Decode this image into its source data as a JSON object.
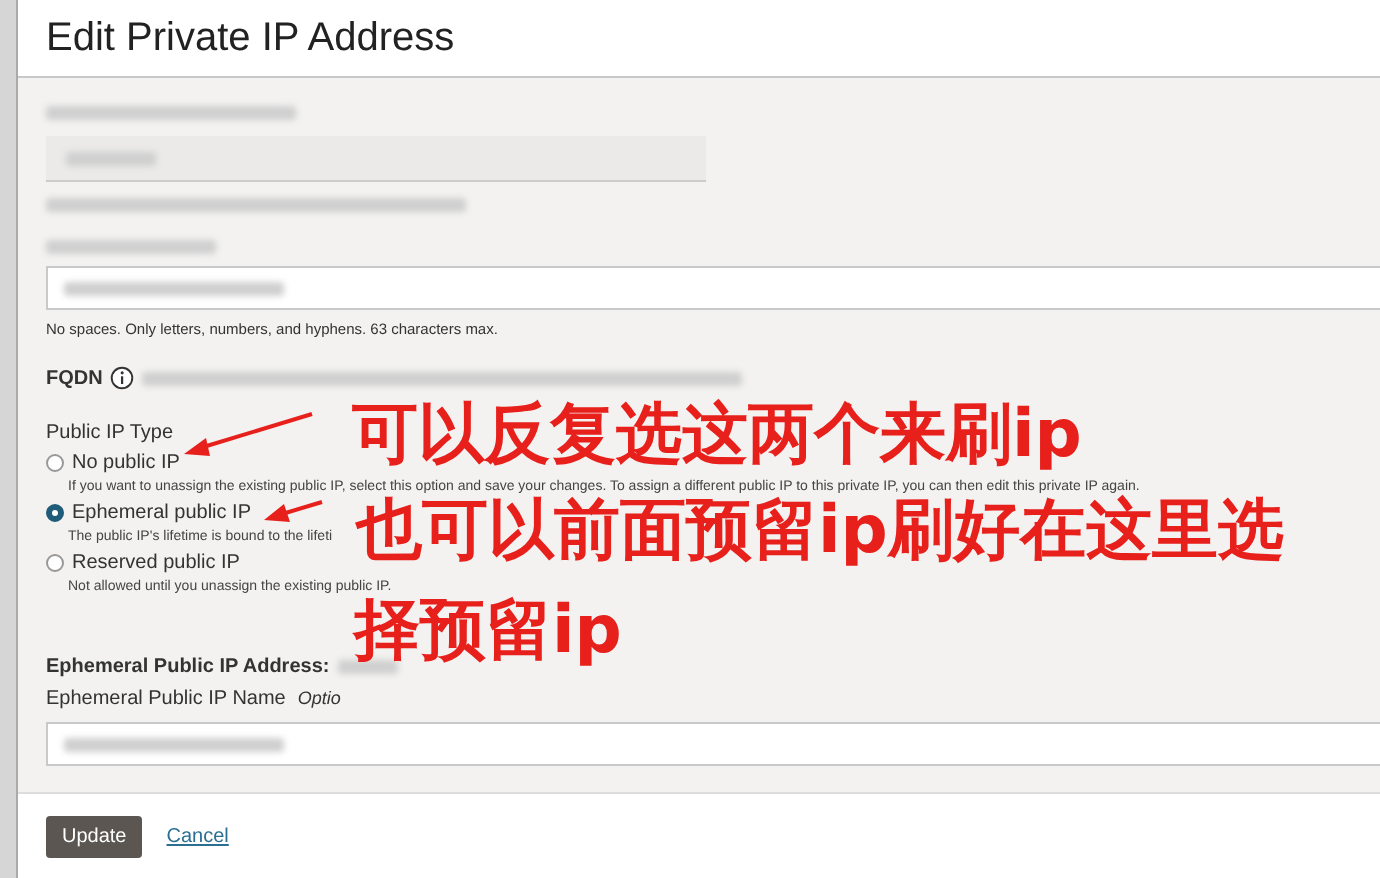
{
  "dialog": {
    "title": "Edit Private IP Address"
  },
  "hostname_hint": "No spaces. Only letters, numbers, and hyphens. 63 characters max.",
  "fqdn": {
    "label": "FQDN"
  },
  "public_ip_type": {
    "label": "Public IP Type",
    "options": [
      {
        "label": "No public IP",
        "description": "If you want to unassign the existing public IP, select this option and save your changes. To assign a different public IP to this private IP, you can then edit this private IP again.",
        "selected": false
      },
      {
        "label": "Ephemeral public IP",
        "description": "The public IP's lifetime is bound to the lifeti",
        "selected": true
      },
      {
        "label": "Reserved public IP",
        "description": "Not allowed until you unassign the existing public IP.",
        "selected": false
      }
    ]
  },
  "ephemeral": {
    "address_label": "Ephemeral Public IP Address:",
    "name_label": "Ephemeral Public IP Name",
    "optional": "Optio"
  },
  "buttons": [
    {
      "label": "Update",
      "kind": "primary"
    },
    {
      "label": "Cancel",
      "kind": "link"
    }
  ],
  "annotation": {
    "lines": [
      "可以反复选这两个来刷ip",
      "也可以前面预留ip刷好在这里选",
      "择预留ip"
    ]
  }
}
